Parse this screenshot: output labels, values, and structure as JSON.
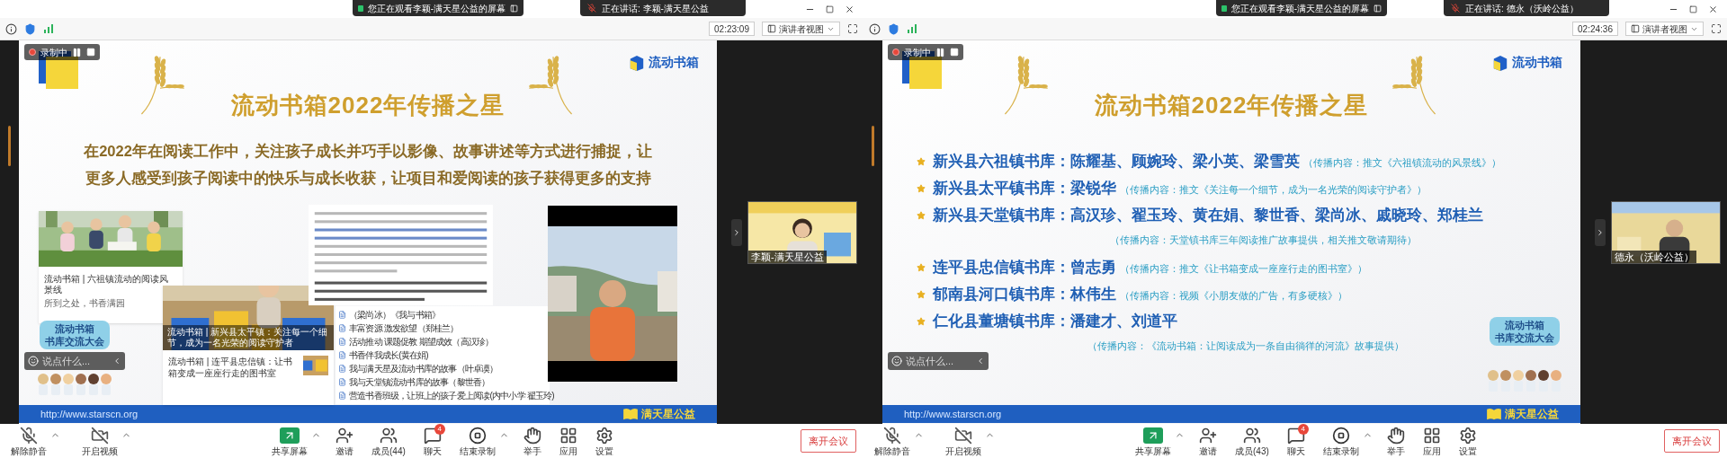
{
  "windows": [
    {
      "share_banner": "您正在观看李颖-满天星公益的屏幕",
      "speaker_banner": "正在讲话: 李颖-满天星公益",
      "timer": "02:23:09",
      "view_button": "演讲者视图",
      "recording_label": "录制中",
      "chat_placeholder": "说点什么...",
      "participant_name": "李颖-满天星公益",
      "slide": {
        "kind": "collage",
        "logo_text": "流动书箱",
        "title": "流动书箱2022年传播之星",
        "intro": [
          "在2022年在阅读工作中，关注孩子成长并巧手以影像、故事讲述等方式进行捕捉，让",
          "更多人感受到孩子阅读中的快乐与成长收获，让项目和爱阅读的孩子获得更多的支持"
        ],
        "cards": [
          {
            "title": "流动书箱 | 六祖镇流动的阅读风景线",
            "source": "所到之处，书香满园"
          },
          {
            "title": "流动书箱 | 新兴县太平镇：关注每一个细节，成为一名光荣的阅读守护者"
          },
          {
            "title": "流动书箱 | 连平县忠信镇：让书箱变成一座座行走的图书室"
          }
        ],
        "articles": [
          "（梁尚冰）《我与书箱》",
          "丰富资源  激发欲望（郑桂兰）",
          "活动推动  课题促教  期望成效（高汉珍）",
          "书香伴我成长(黄在娟)",
          "我与满天星及流动书库的故事（叶卓谟）",
          "我与天堂镇流动书库的故事（黎世香）",
          "营造书香班级，让班上的孩子爱上阅读(内中小学  翟玉玲)"
        ],
        "sticker": [
          "流动书箱",
          "书库交流大会"
        ],
        "url": "http://www.starscn.org",
        "footer_logo": "满天星公益"
      },
      "toolbar": [
        {
          "kind": "mic",
          "label": "解除静音",
          "caret": true
        },
        {
          "kind": "video",
          "label": "开启视频",
          "caret": true
        },
        {
          "kind": "share",
          "label": "共享屏幕",
          "caret": true
        },
        {
          "kind": "invite",
          "label": "邀请",
          "caret": false
        },
        {
          "kind": "members",
          "label": "成员(44)",
          "caret": false
        },
        {
          "kind": "chat",
          "label": "聊天",
          "caret": false,
          "badge": "4"
        },
        {
          "kind": "record",
          "label": "结束录制",
          "caret": true
        },
        {
          "kind": "hand",
          "label": "举手",
          "caret": false
        },
        {
          "kind": "apps",
          "label": "应用",
          "caret": false
        },
        {
          "kind": "settings",
          "label": "设置",
          "caret": false
        }
      ],
      "leave_button": "离开会议"
    },
    {
      "share_banner": "您正在观看李颖-满天星公益的屏幕",
      "speaker_banner": "正在讲话: 德永（沃岭公益）",
      "timer": "02:24:36",
      "view_button": "演讲者视图",
      "recording_label": "录制中",
      "chat_placeholder": "说点什么...",
      "participant_name": "德永（沃岭公益）",
      "slide": {
        "kind": "list",
        "logo_text": "流动书箱",
        "title": "流动书箱2022年传播之星",
        "entries": [
          {
            "kind": "inline",
            "library": "新兴县六祖镇书库：",
            "names": "陈耀基、顾婉玲、梁小英、梁雪英",
            "note": "（传播内容：推文《六祖镇流动的风景线》）"
          },
          {
            "kind": "inline",
            "library": "新兴县太平镇书库：",
            "names": "梁锐华",
            "note": "（传播内容：推文《关注每一个细节，成为一名光荣的阅读守护者》）"
          },
          {
            "kind": "below",
            "library": "新兴县天堂镇书库：",
            "names": "高汉珍、翟玉玲、黄在娟、黎世香、梁尚冰、戚晓玲、郑桂兰",
            "note": "（传播内容：天堂镇书库三年阅读推广故事提供，相关推文敬请期待）"
          },
          {
            "kind": "inline",
            "library": "连平县忠信镇书库：",
            "names": "曾志勇",
            "note": "（传播内容：推文《让书箱变成一座座行走的图书室》）"
          },
          {
            "kind": "inline",
            "library": "郁南县河口镇书库：",
            "names": "林伟生",
            "note": "（传播内容：视频《小朋友做的广告，有多硬核》）"
          },
          {
            "kind": "below",
            "library": "仁化县董塘镇书库：",
            "names": "潘建才、刘道平",
            "note": "（传播内容：《流动书箱：让阅读成为一条自由徜徉的河流》故事提供）"
          }
        ],
        "sticker": [
          "流动书箱",
          "书库交流大会"
        ],
        "url": "http://www.starscn.org",
        "footer_logo": "满天星公益"
      },
      "toolbar": [
        {
          "kind": "mic",
          "label": "解除静音",
          "caret": true
        },
        {
          "kind": "video",
          "label": "开启视频",
          "caret": true
        },
        {
          "kind": "share",
          "label": "共享屏幕",
          "caret": true
        },
        {
          "kind": "invite",
          "label": "邀请",
          "caret": false
        },
        {
          "kind": "members",
          "label": "成员(43)",
          "caret": false
        },
        {
          "kind": "chat",
          "label": "聊天",
          "caret": false,
          "badge": "4"
        },
        {
          "kind": "record",
          "label": "结束录制",
          "caret": true
        },
        {
          "kind": "hand",
          "label": "举手",
          "caret": false
        },
        {
          "kind": "apps",
          "label": "应用",
          "caret": false
        },
        {
          "kind": "settings",
          "label": "设置",
          "caret": false
        }
      ],
      "leave_button": "离开会议"
    }
  ]
}
